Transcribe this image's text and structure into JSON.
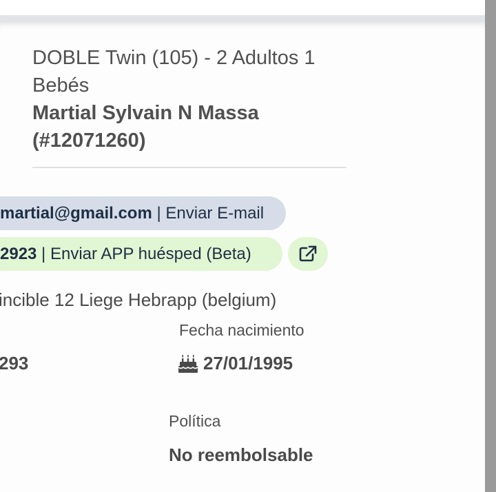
{
  "room": {
    "title": "DOBLE Twin (105) - 2 Adultos 1 Bebés"
  },
  "guest": {
    "name": "Martial Sylvain N Massa (#12071260)",
    "email_partial": "martial@gmail.com",
    "email_action": " | Enviar E-mail",
    "phone_partial": "2923",
    "app_action": " | Enviar APP huésped (Beta)",
    "address": "incible 12 Liege Hebrapp (belgium)",
    "phone_value_partial": "293"
  },
  "birth": {
    "label": "Fecha nacimiento",
    "value": "27/01/1995"
  },
  "policy": {
    "label": "Política",
    "value": "No reembolsable"
  },
  "icons": {
    "external_link": "external-link-icon",
    "birthday": "birthday-cake-icon"
  },
  "colors": {
    "email_pill": "#d6dde9",
    "app_pill": "#e1f6d2",
    "pill_text": "#1f2f45"
  }
}
